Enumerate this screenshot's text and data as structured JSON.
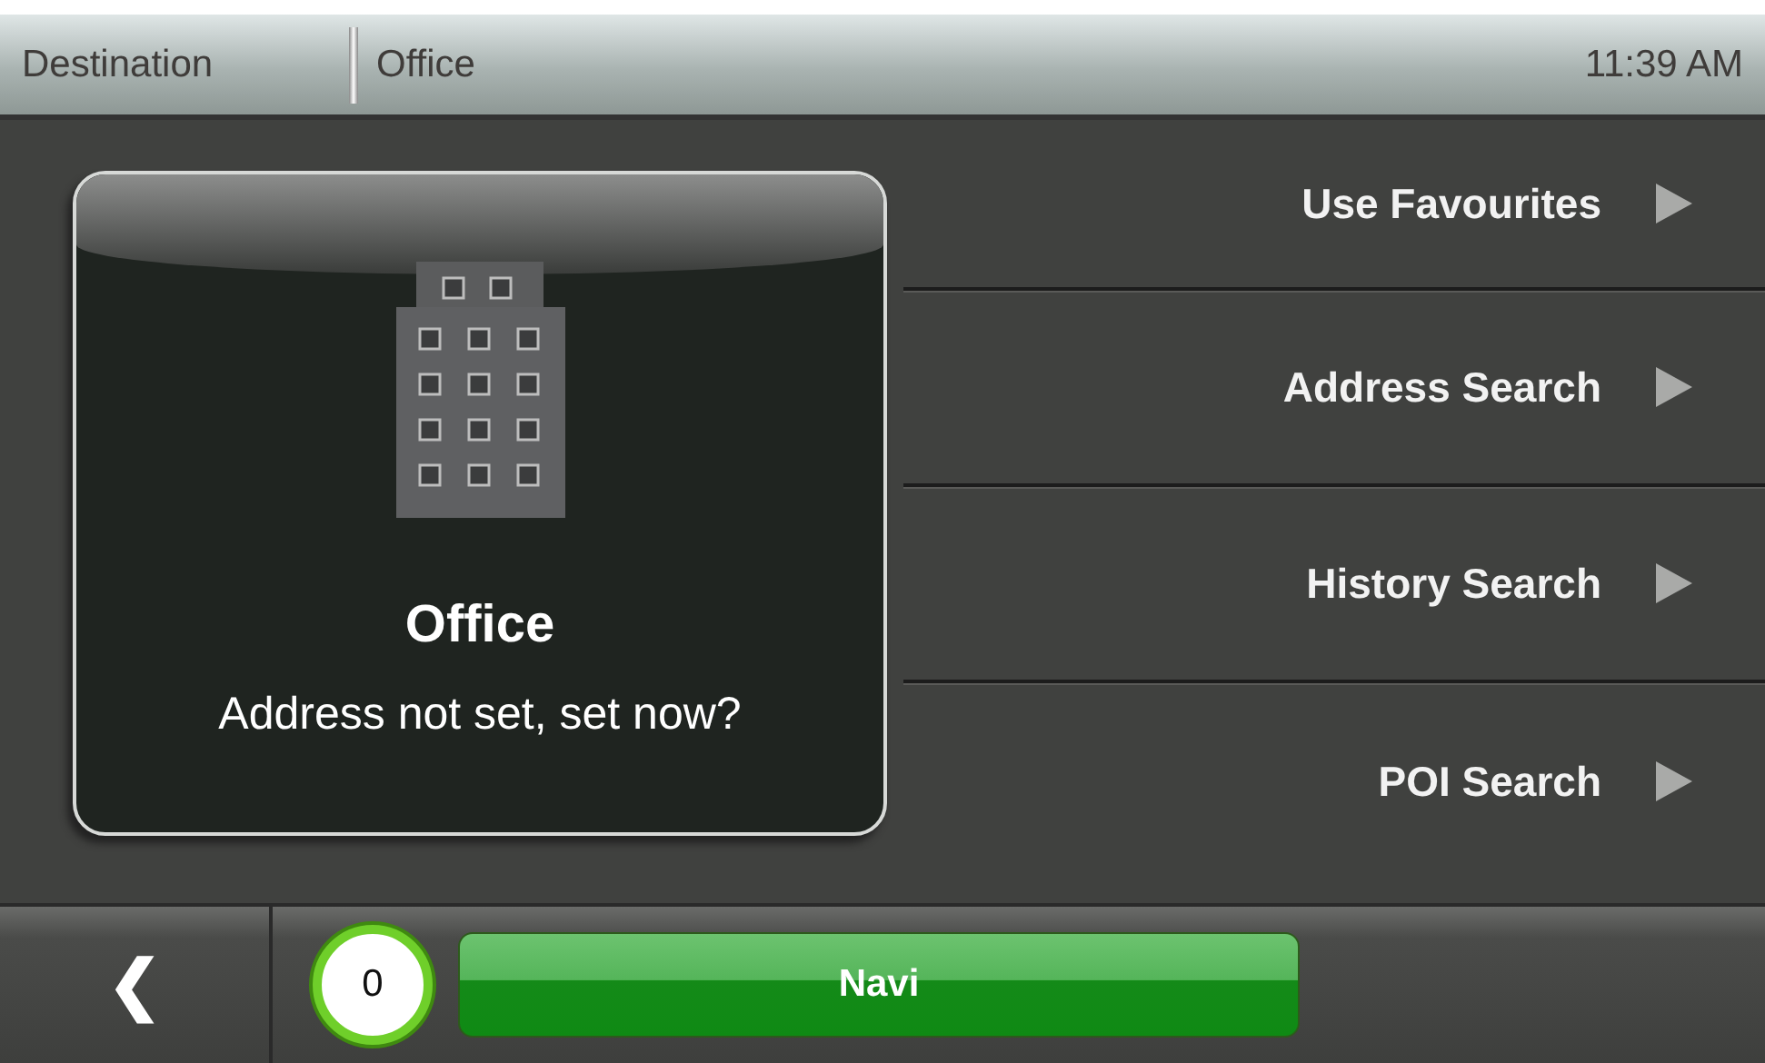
{
  "title_bar": {
    "section": "Destination",
    "page": "Office",
    "time": "11:39 AM"
  },
  "place_card": {
    "name": "Office",
    "message": "Address not set, set now?"
  },
  "menu": [
    {
      "label": "Use Favourites"
    },
    {
      "label": "Address Search"
    },
    {
      "label": "History Search"
    },
    {
      "label": "POI Search"
    }
  ],
  "bottom_bar": {
    "back": "❮",
    "counter": "0",
    "navi": "Navi"
  }
}
